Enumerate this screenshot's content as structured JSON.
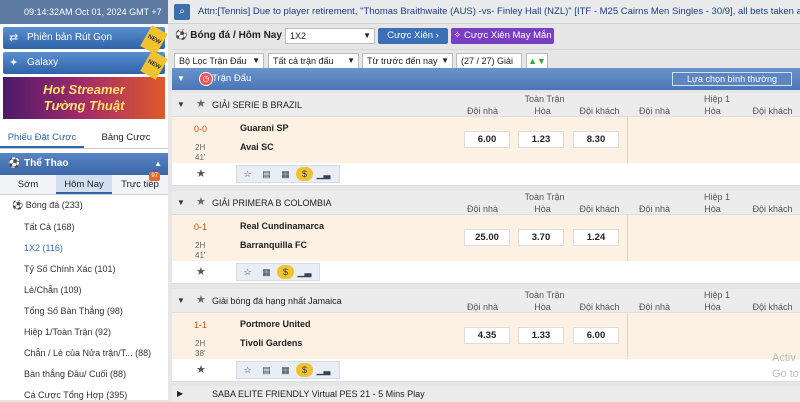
{
  "topbar": {
    "clock": "09:14:32AM Oct 01, 2024 GMT +7",
    "ticker": "Attn:[Tennis] Due to player retirement, \"Thomas Braithwaite (AUS) -vs- Finley Hall (NZL)\" [ITF - M25 Cairns Men Singles - 30/9], all bets taken are a"
  },
  "left": {
    "banners": [
      {
        "label": "Phiên bản Rút Gọn",
        "tag": "NEW"
      },
      {
        "label": "Galaxy",
        "tag": "NEW"
      }
    ],
    "promo_line1": "Hot Streamer",
    "promo_line2": "Tường Thuật",
    "tabs": [
      "Phiếu Đặt Cược",
      "Bảng Cược"
    ],
    "sport_header": "Thể Thao",
    "subtabs": [
      "Sớm",
      "Hôm Nay",
      "Trực tiếp"
    ],
    "live_count": "97",
    "menu": [
      "Bóng đá  (233)",
      "Tất Cả  (168)",
      "1X2  (116)",
      "Tỷ Số Chính Xác  (101)",
      "Lẻ/Chẵn  (109)",
      "Tổng Số Bàn Thắng  (98)",
      "Hiệp 1/Toàn Trận  (92)",
      "Chẵn / Lẻ của Nửa trận/T...  (88)",
      "Bàn thắng Đầu/ Cuối  (88)",
      "Cá Cược Tổng Hợp  (395)"
    ]
  },
  "main": {
    "title": "Bóng đá / Hôm Nay",
    "market_select": "1X2",
    "btn_parlay": "Cược Xiên",
    "btn_lucky": "Cược Xiên May Mắn",
    "filters": [
      "Bộ Lọc Trận Đấu",
      "Tất cả trận đấu",
      "Từ trước đến nay"
    ],
    "count": "(27 / 27) Giải",
    "panel_title": "Trận Đấu",
    "sort_select": "Lựa chọn bình thường",
    "col_groups": [
      "Toàn Trận",
      "Hiệp 1"
    ],
    "col_headers": [
      "Đội nhà",
      "Hòa",
      "Đội khách"
    ],
    "leagues": [
      {
        "name": "GIẢI SERIE B BRAZIL",
        "score": "0-0",
        "period": "2H",
        "minute": "41'",
        "home": "Guarani SP",
        "away": "Avai SC",
        "odds": [
          "6.00",
          "1.23",
          "8.30"
        ]
      },
      {
        "name": "GIẢI PRIMERA B COLOMBIA",
        "score": "0-1",
        "period": "2H",
        "minute": "41'",
        "home": "Real Cundinamarca",
        "away": "Barranquilla FC",
        "odds": [
          "25.00",
          "3.70",
          "1.24"
        ]
      },
      {
        "name": "Giải bóng đá hạng nhất Jamaica",
        "score": "1-1",
        "period": "2H",
        "minute": "38'",
        "home": "Portmore United",
        "away": "Tivoli Gardens",
        "odds": [
          "4.35",
          "1.33",
          "6.00"
        ]
      }
    ],
    "next_league": "SABA ELITE FRIENDLY Virtual PES 21 - 5 Mins Play"
  },
  "watermark": [
    "Activ",
    "Go to"
  ]
}
